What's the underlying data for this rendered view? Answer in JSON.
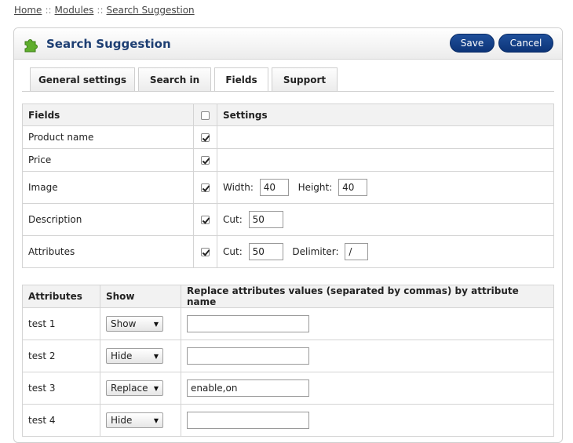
{
  "breadcrumb": {
    "home": "Home",
    "modules": "Modules",
    "current": "Search Suggestion",
    "separator": "::"
  },
  "header": {
    "title": "Search Suggestion",
    "save_label": "Save",
    "cancel_label": "Cancel"
  },
  "tabs": [
    {
      "label": "General settings"
    },
    {
      "label": "Search in"
    },
    {
      "label": "Fields",
      "active": true
    },
    {
      "label": "Support"
    }
  ],
  "fields_table": {
    "headers": {
      "fields": "Fields",
      "settings": "Settings"
    },
    "rows": [
      {
        "name": "Product name",
        "checked": true
      },
      {
        "name": "Price",
        "checked": true
      },
      {
        "name": "Image",
        "checked": true,
        "width_label": "Width:",
        "width_value": "40",
        "height_label": "Height:",
        "height_value": "40"
      },
      {
        "name": "Description",
        "checked": true,
        "cut_label": "Cut:",
        "cut_value": "50"
      },
      {
        "name": "Attributes",
        "checked": true,
        "cut_label": "Cut:",
        "cut_value": "50",
        "delimiter_label": "Delimiter:",
        "delimiter_value": "/"
      }
    ]
  },
  "attributes_table": {
    "headers": {
      "attributes": "Attributes",
      "show": "Show",
      "replace": "Replace attributes values (separated by commas) by attribute name"
    },
    "rows": [
      {
        "name": "test 1",
        "show": "Show",
        "replace": ""
      },
      {
        "name": "test 2",
        "show": "Hide",
        "replace": ""
      },
      {
        "name": "test 3",
        "show": "Replace",
        "replace": "enable,on"
      },
      {
        "name": "test 4",
        "show": "Hide",
        "replace": ""
      }
    ]
  },
  "colors": {
    "accent": "#0c3478",
    "title": "#1e3f73",
    "icon_green": "#5fae2d"
  }
}
